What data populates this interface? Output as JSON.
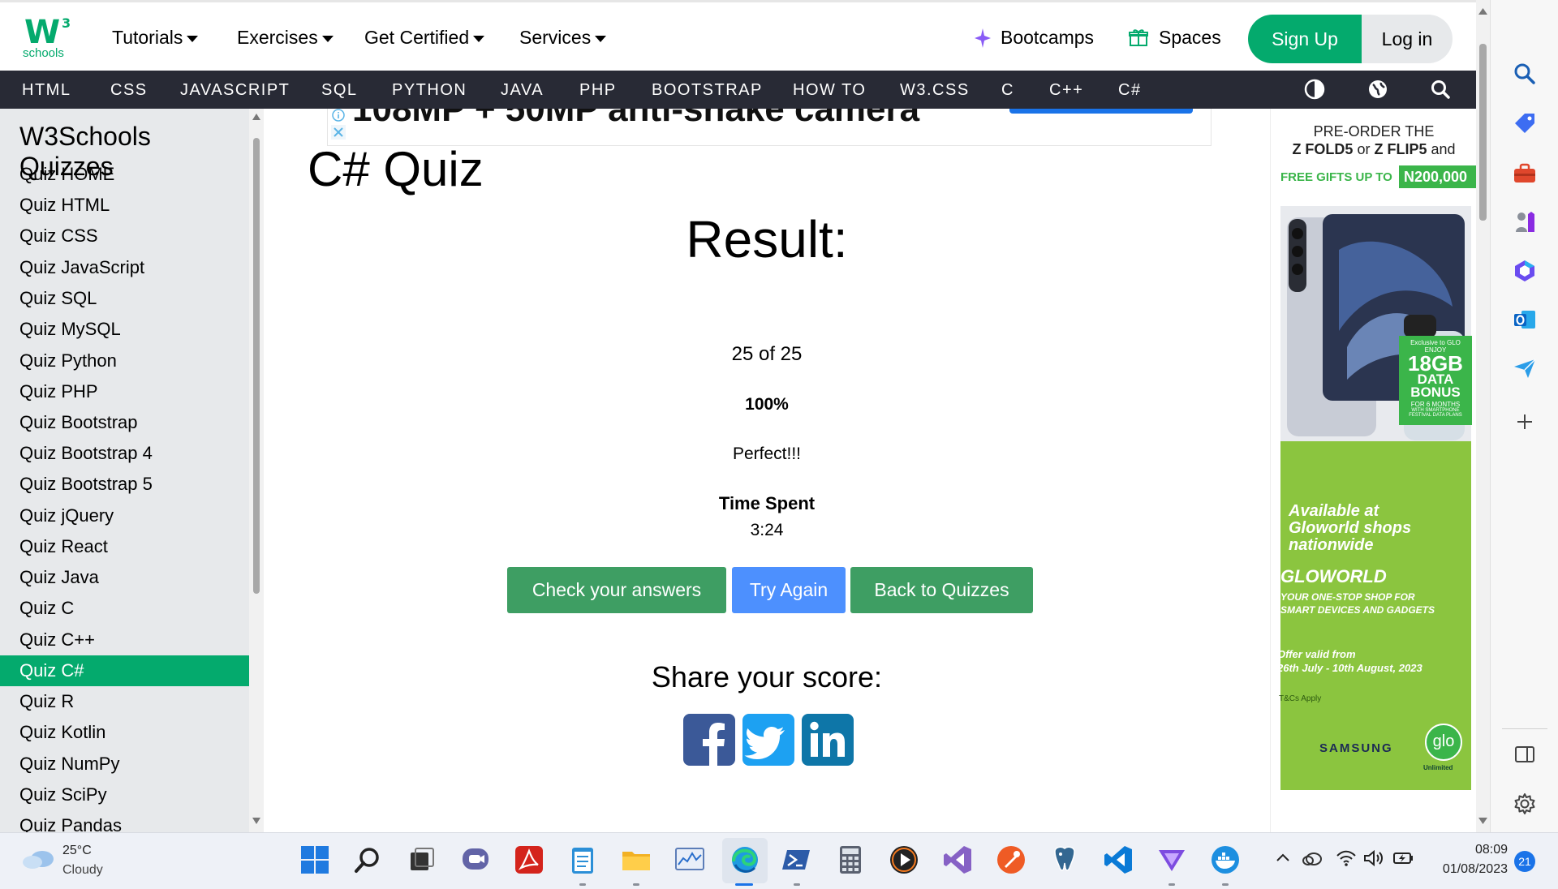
{
  "brand": {
    "logo_mark": "W",
    "logo_sup": "3",
    "logo_text": "schools"
  },
  "topnav": {
    "menus": [
      "Tutorials",
      "Exercises",
      "Get Certified",
      "Services"
    ],
    "bootcamps": "Bootcamps",
    "spaces": "Spaces",
    "signup": "Sign Up",
    "login": "Log in"
  },
  "darkbar": {
    "items": [
      "HTML",
      "CSS",
      "JAVASCRIPT",
      "SQL",
      "PYTHON",
      "JAVA",
      "PHP",
      "BOOTSTRAP",
      "HOW TO",
      "W3.CSS",
      "C",
      "C++",
      "C#"
    ]
  },
  "sidebar": {
    "title": "W3Schools Quizzes",
    "items": [
      "Quiz HOME",
      "Quiz HTML",
      "Quiz CSS",
      "Quiz JavaScript",
      "Quiz SQL",
      "Quiz MySQL",
      "Quiz Python",
      "Quiz PHP",
      "Quiz Bootstrap",
      "Quiz Bootstrap 4",
      "Quiz Bootstrap 5",
      "Quiz jQuery",
      "Quiz React",
      "Quiz Java",
      "Quiz C",
      "Quiz C++",
      "Quiz C#",
      "Quiz R",
      "Quiz Kotlin",
      "Quiz NumPy",
      "Quiz SciPy",
      "Quiz Pandas"
    ],
    "active_item": "Quiz C#"
  },
  "main": {
    "ad_text": "108MP + 50MP anti-shake camera",
    "page_title": "C# Quiz",
    "result_heading": "Result:",
    "score": "25 of 25",
    "percent": "100%",
    "verdict": "Perfect!!!",
    "time_label": "Time Spent",
    "time_value": "3:24",
    "buttons": {
      "check": "Check your answers",
      "try_again": "Try Again",
      "back": "Back to Quizzes"
    },
    "share_heading": "Share your score:"
  },
  "ad_right": {
    "line1": "PRE-ORDER THE",
    "line2a": "Z FOLD5",
    "line2b": "or",
    "line2c": "Z FLIP5",
    "line2d": "and",
    "free_gifts": "FREE GIFTS UP TO",
    "amount": "N200,000",
    "exclusive": "Exclusive to GLO",
    "enjoy": "ENJOY",
    "data_gb": "18GB",
    "data_bonus1": "DATA",
    "data_bonus2": "BONUS",
    "for_months": "FOR 6 MONTHS",
    "with_smartphone": "WITH SMARTPHONE",
    "festival_plans": "FESTIVAL DATA PLANS",
    "available": "Available at",
    "gloworld_shops": "Gloworld shops",
    "nationwide": "nationwide",
    "gloworld": "GLOWORLD",
    "tagline1": "YOUR ONE-STOP SHOP FOR",
    "tagline2": "SMART DEVICES AND GADGETS",
    "offer_label": "Offer valid from",
    "offer_dates": "26th July - 10th August, 2023",
    "tcs": "T&Cs Apply",
    "samsung": "SAMSUNG",
    "glo": "glo",
    "unlimited": "Unlimited"
  },
  "taskbar": {
    "weather_temp": "25°C",
    "weather_desc": "Cloudy",
    "time": "08:09",
    "date": "01/08/2023",
    "notifications": "21"
  },
  "colors": {
    "w3green": "#04AA6D",
    "dark": "#282A35",
    "blue_btn": "#4d90fe",
    "sidebar_bg": "#E7E9EB"
  }
}
